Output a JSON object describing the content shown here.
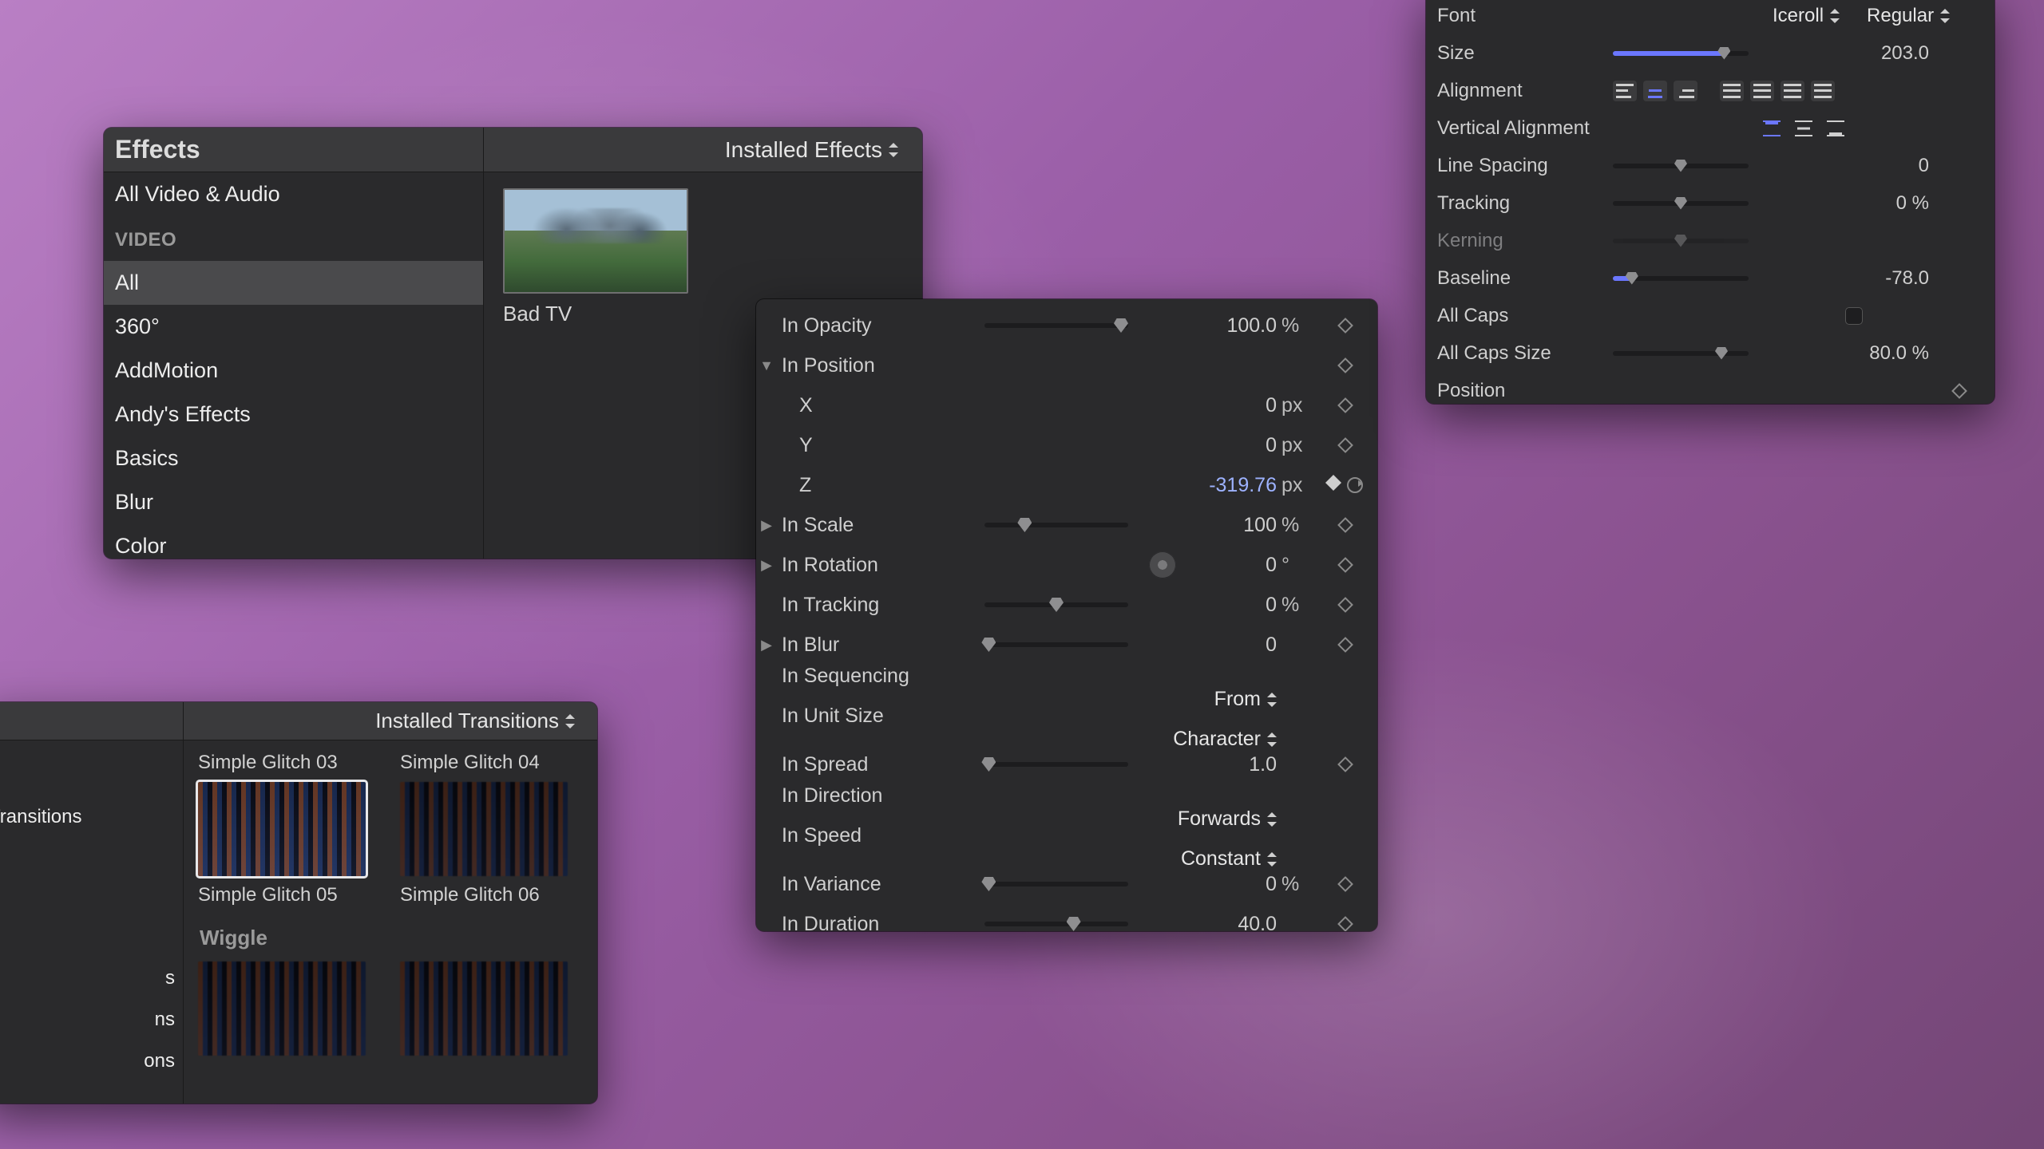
{
  "effects": {
    "title": "Effects",
    "dropdown": "Installed Effects",
    "sidebar": {
      "top": "All Video & Audio",
      "group": "VIDEO",
      "items": [
        "All",
        "360°",
        "AddMotion",
        "Andy's Effects",
        "Basics",
        "Blur",
        "Color"
      ],
      "selected_index": 0
    },
    "thumb_label": "Bad TV"
  },
  "transitions": {
    "dropdown": "Installed Transitions",
    "sidebar_items": [
      "Transitions",
      "s",
      "ns",
      "ons"
    ],
    "row1": [
      "Simple Glitch 03",
      "Simple Glitch 04"
    ],
    "row2": [
      "Simple Glitch 05",
      "Simple Glitch 06"
    ],
    "section": "Wiggle"
  },
  "in_panel": {
    "rows": [
      {
        "label": "In Opacity",
        "tri": "",
        "ctrl": "slider",
        "knob": 95,
        "value": "100.0",
        "unit": "%",
        "kf": "diamond"
      },
      {
        "label": "In Position",
        "tri": "down",
        "ctrl": "none",
        "value": "",
        "unit": "",
        "kf": "diamond"
      },
      {
        "label": "X",
        "tri": "",
        "sub": true,
        "ctrl": "none",
        "value": "0",
        "unit": "px",
        "kf": "diamond"
      },
      {
        "label": "Y",
        "tri": "",
        "sub": true,
        "ctrl": "none",
        "value": "0",
        "unit": "px",
        "kf": "diamond"
      },
      {
        "label": "Z",
        "tri": "",
        "sub": true,
        "ctrl": "none",
        "value": "-319.76",
        "unit": "px",
        "kf": "diamond-solid",
        "hot": true,
        "reset": true
      },
      {
        "label": "In Scale",
        "tri": "right",
        "ctrl": "slider",
        "knob": 28,
        "value": "100",
        "unit": "%",
        "kf": "diamond"
      },
      {
        "label": "In Rotation",
        "tri": "right",
        "ctrl": "dial",
        "value": "0",
        "unit": "°",
        "kf": "diamond"
      },
      {
        "label": "In Tracking",
        "tri": "",
        "ctrl": "slider",
        "knob": 50,
        "value": "0",
        "unit": "%",
        "kf": "diamond"
      },
      {
        "label": "In Blur",
        "tri": "right",
        "ctrl": "slider",
        "knob": 3,
        "value": "0",
        "unit": "",
        "kf": "diamond"
      },
      {
        "label": "In Sequencing",
        "tri": "",
        "ctrl": "dropdown",
        "value": "From",
        "unit": "",
        "kf": ""
      },
      {
        "label": "In Unit Size",
        "tri": "",
        "ctrl": "dropdown",
        "value": "Character",
        "unit": "",
        "kf": ""
      },
      {
        "label": "In Spread",
        "tri": "",
        "ctrl": "slider",
        "knob": 3,
        "value": "1.0",
        "unit": "",
        "kf": "diamond"
      },
      {
        "label": "In Direction",
        "tri": "",
        "ctrl": "dropdown",
        "value": "Forwards",
        "unit": "",
        "kf": ""
      },
      {
        "label": "In Speed",
        "tri": "",
        "ctrl": "dropdown",
        "value": "Constant",
        "unit": "",
        "kf": ""
      },
      {
        "label": "In Variance",
        "tri": "",
        "ctrl": "slider",
        "knob": 3,
        "value": "0",
        "unit": "%",
        "kf": "diamond"
      },
      {
        "label": "In Duration",
        "tri": "",
        "ctrl": "slider",
        "knob": 62,
        "value": "40.0",
        "unit": "",
        "kf": "diamond"
      }
    ]
  },
  "text_panel": {
    "font_label": "Font",
    "font_family": "Iceroll",
    "font_style": "Regular",
    "rows": {
      "size": {
        "label": "Size",
        "value": "203.0",
        "knob": 82,
        "fill": 82
      },
      "alignment": {
        "label": "Alignment"
      },
      "valign": {
        "label": "Vertical Alignment"
      },
      "linespacing": {
        "label": "Line Spacing",
        "value": "0",
        "knob": 50
      },
      "tracking": {
        "label": "Tracking",
        "value": "0 %",
        "knob": 50
      },
      "kerning": {
        "label": "Kerning",
        "knob": 50
      },
      "baseline": {
        "label": "Baseline",
        "value": "-78.0",
        "knob": 12,
        "fill": 12
      },
      "allcaps": {
        "label": "All Caps"
      },
      "allcapssize": {
        "label": "All Caps Size",
        "value": "80.0 %",
        "knob": 80
      },
      "position": {
        "label": "Position"
      }
    }
  }
}
